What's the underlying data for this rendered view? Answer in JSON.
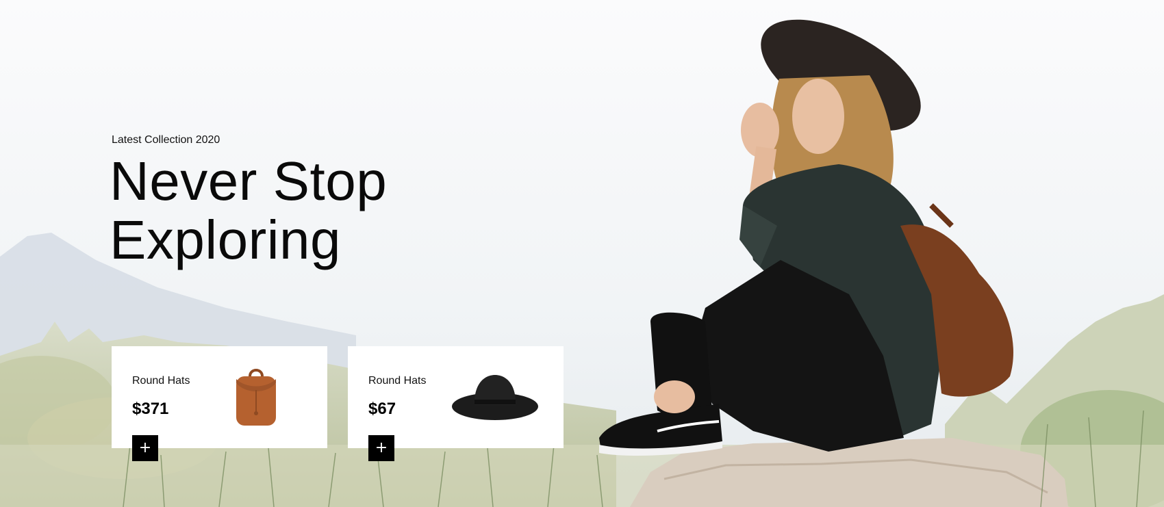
{
  "hero": {
    "subtitle": "Latest Collection 2020",
    "headline_line1": "Never Stop",
    "headline_line2": "Exploring"
  },
  "products": [
    {
      "name": "Round Hats",
      "price": "$371",
      "image": "brown-backpack",
      "add_icon": "+"
    },
    {
      "name": "Round Hats",
      "price": "$67",
      "image": "black-wide-brim-hat",
      "add_icon": "+"
    }
  ],
  "colors": {
    "sky": "#f7f8f9",
    "card": "#ffffff",
    "button": "#000000",
    "text": "#111111",
    "backpack": "#b5612f",
    "hat": "#1c1c1c"
  }
}
